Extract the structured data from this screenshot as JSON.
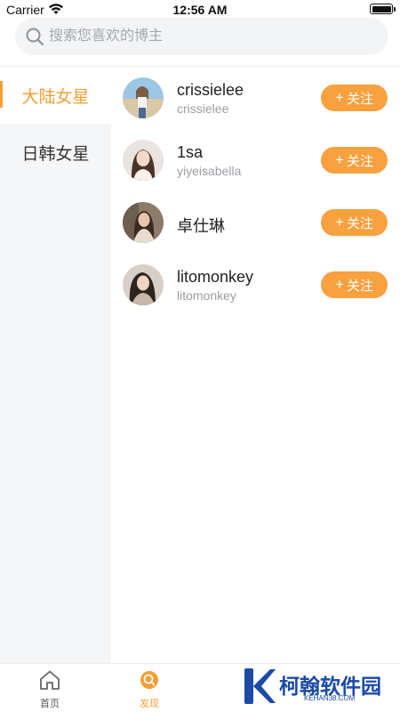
{
  "status_bar": {
    "carrier": "Carrier",
    "time": "12:56 AM"
  },
  "search": {
    "placeholder": "搜索您喜欢的博主"
  },
  "categories": [
    {
      "label": "大陆女星",
      "active": true
    },
    {
      "label": "日韩女星",
      "active": false
    }
  ],
  "bloggers": [
    {
      "name": "crissielee",
      "handle": "crissielee",
      "follow_plus": "+",
      "follow_label": "关注"
    },
    {
      "name": "1sa",
      "handle": "yiyeisabella",
      "follow_plus": "+",
      "follow_label": "关注"
    },
    {
      "name": "卓仕琳",
      "handle": "",
      "follow_plus": "+",
      "follow_label": "关注"
    },
    {
      "name": "litomonkey",
      "handle": "litomonkey",
      "follow_plus": "+",
      "follow_label": "关注"
    }
  ],
  "tabbar": [
    {
      "label": "首页",
      "icon": "home-icon",
      "active": false
    },
    {
      "label": "发现",
      "icon": "discover-icon",
      "active": true
    }
  ],
  "watermark": {
    "brand": "柯翰软件园",
    "domain": "KEHAN38.COM"
  },
  "colors": {
    "accent": "#f59e34",
    "follow_button": "#f9a03f",
    "sidebar_bg": "#f5f6f8",
    "brand_blue": "#1b4aa8"
  }
}
